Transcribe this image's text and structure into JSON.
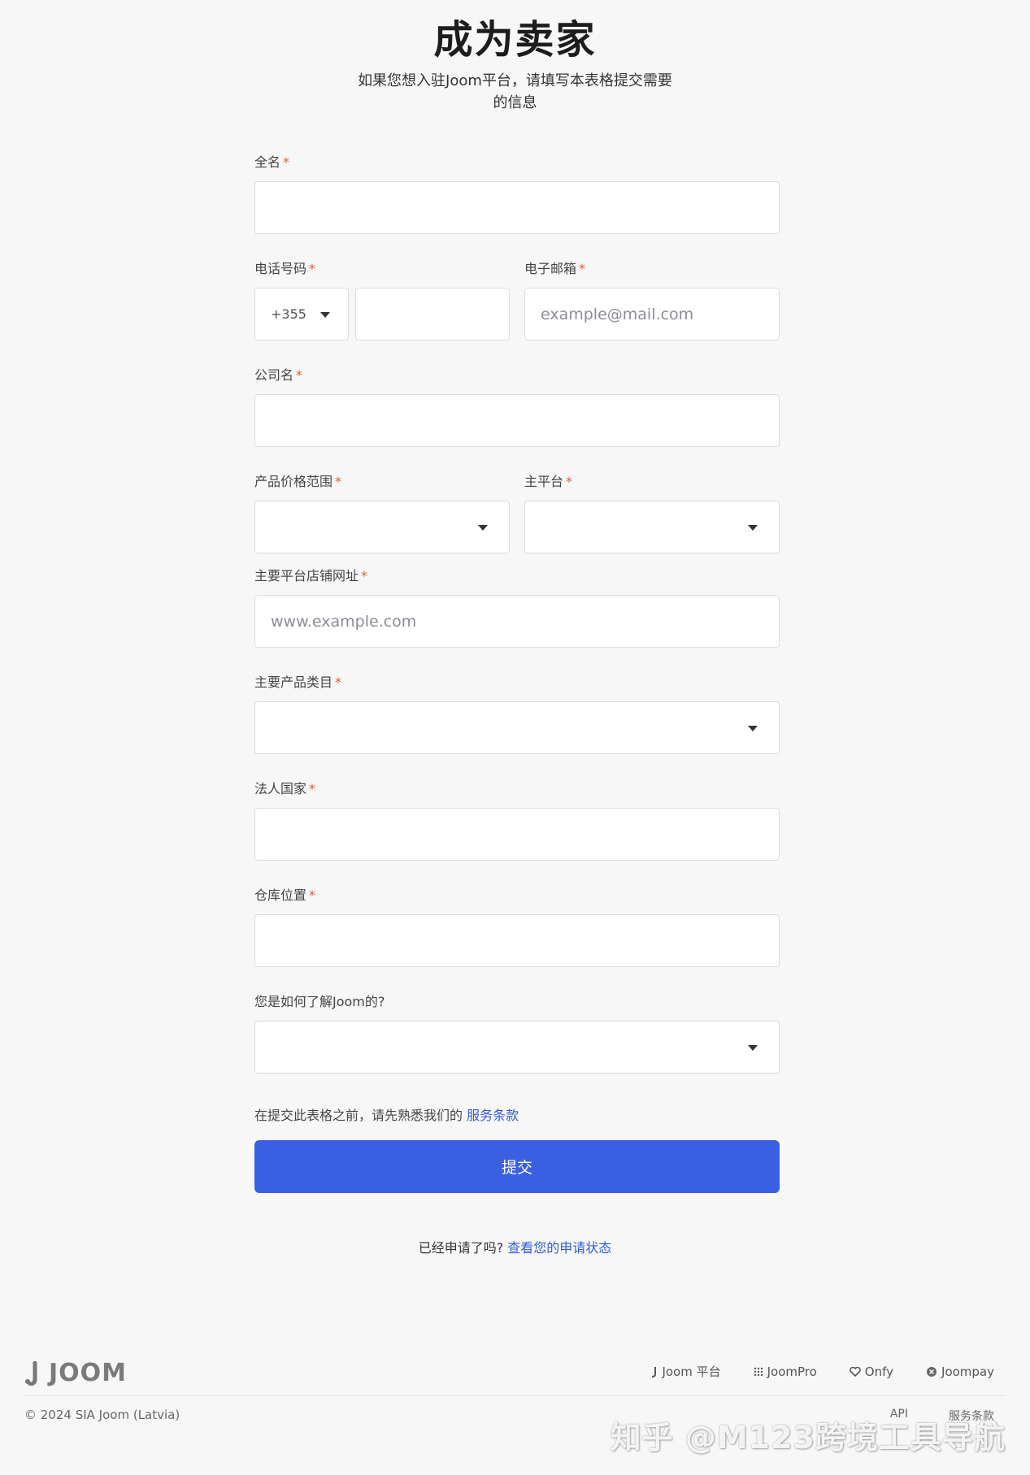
{
  "header": {
    "title": "成为卖家",
    "subtitle": "如果您想入驻Joom平台，请填写本表格提交需要的信息"
  },
  "form": {
    "full_name": {
      "label": "全名",
      "required": "*",
      "value": ""
    },
    "phone": {
      "label": "电话号码",
      "required": "*",
      "country_code": "+355",
      "value": ""
    },
    "email": {
      "label": "电子邮箱",
      "required": "*",
      "placeholder": "example@mail.com"
    },
    "company": {
      "label": "公司名",
      "required": "*",
      "value": ""
    },
    "price_range": {
      "label": "产品价格范围",
      "required": "*",
      "selected": ""
    },
    "main_platform": {
      "label": "主平台",
      "required": "*",
      "selected": ""
    },
    "store_url": {
      "label": "主要平台店铺网址",
      "required": "*",
      "placeholder": "www.example.com"
    },
    "category": {
      "label": "主要产品类目",
      "required": "*",
      "selected": ""
    },
    "legal_country": {
      "label": "法人国家",
      "required": "*",
      "value": ""
    },
    "warehouse": {
      "label": "仓库位置",
      "required": "*",
      "value": ""
    },
    "referral": {
      "label": "您是如何了解Joom的?",
      "selected": ""
    }
  },
  "terms": {
    "text": "在提交此表格之前，请先熟悉我们的 ",
    "link": "服务条款"
  },
  "submit_label": "提交",
  "status": {
    "text": "已经申请了吗? ",
    "link": "查看您的申请状态"
  },
  "footer": {
    "logo_text": "JOOM",
    "links": [
      {
        "icon": "joom-icon",
        "label": "Joom 平台"
      },
      {
        "icon": "grid-icon",
        "label": "JoomPro"
      },
      {
        "icon": "heart-icon",
        "label": "Onfy"
      },
      {
        "icon": "joompay-icon",
        "label": "Joompay"
      }
    ],
    "copyright": "© 2024 SIA Joom (Latvia)",
    "api": "API",
    "terms": "服务条款"
  },
  "watermark": "知乎 @M123跨境工具导航",
  "colors": {
    "accent": "#3a5fe0",
    "link": "#2f5bd8",
    "required": "#e05a2b"
  }
}
